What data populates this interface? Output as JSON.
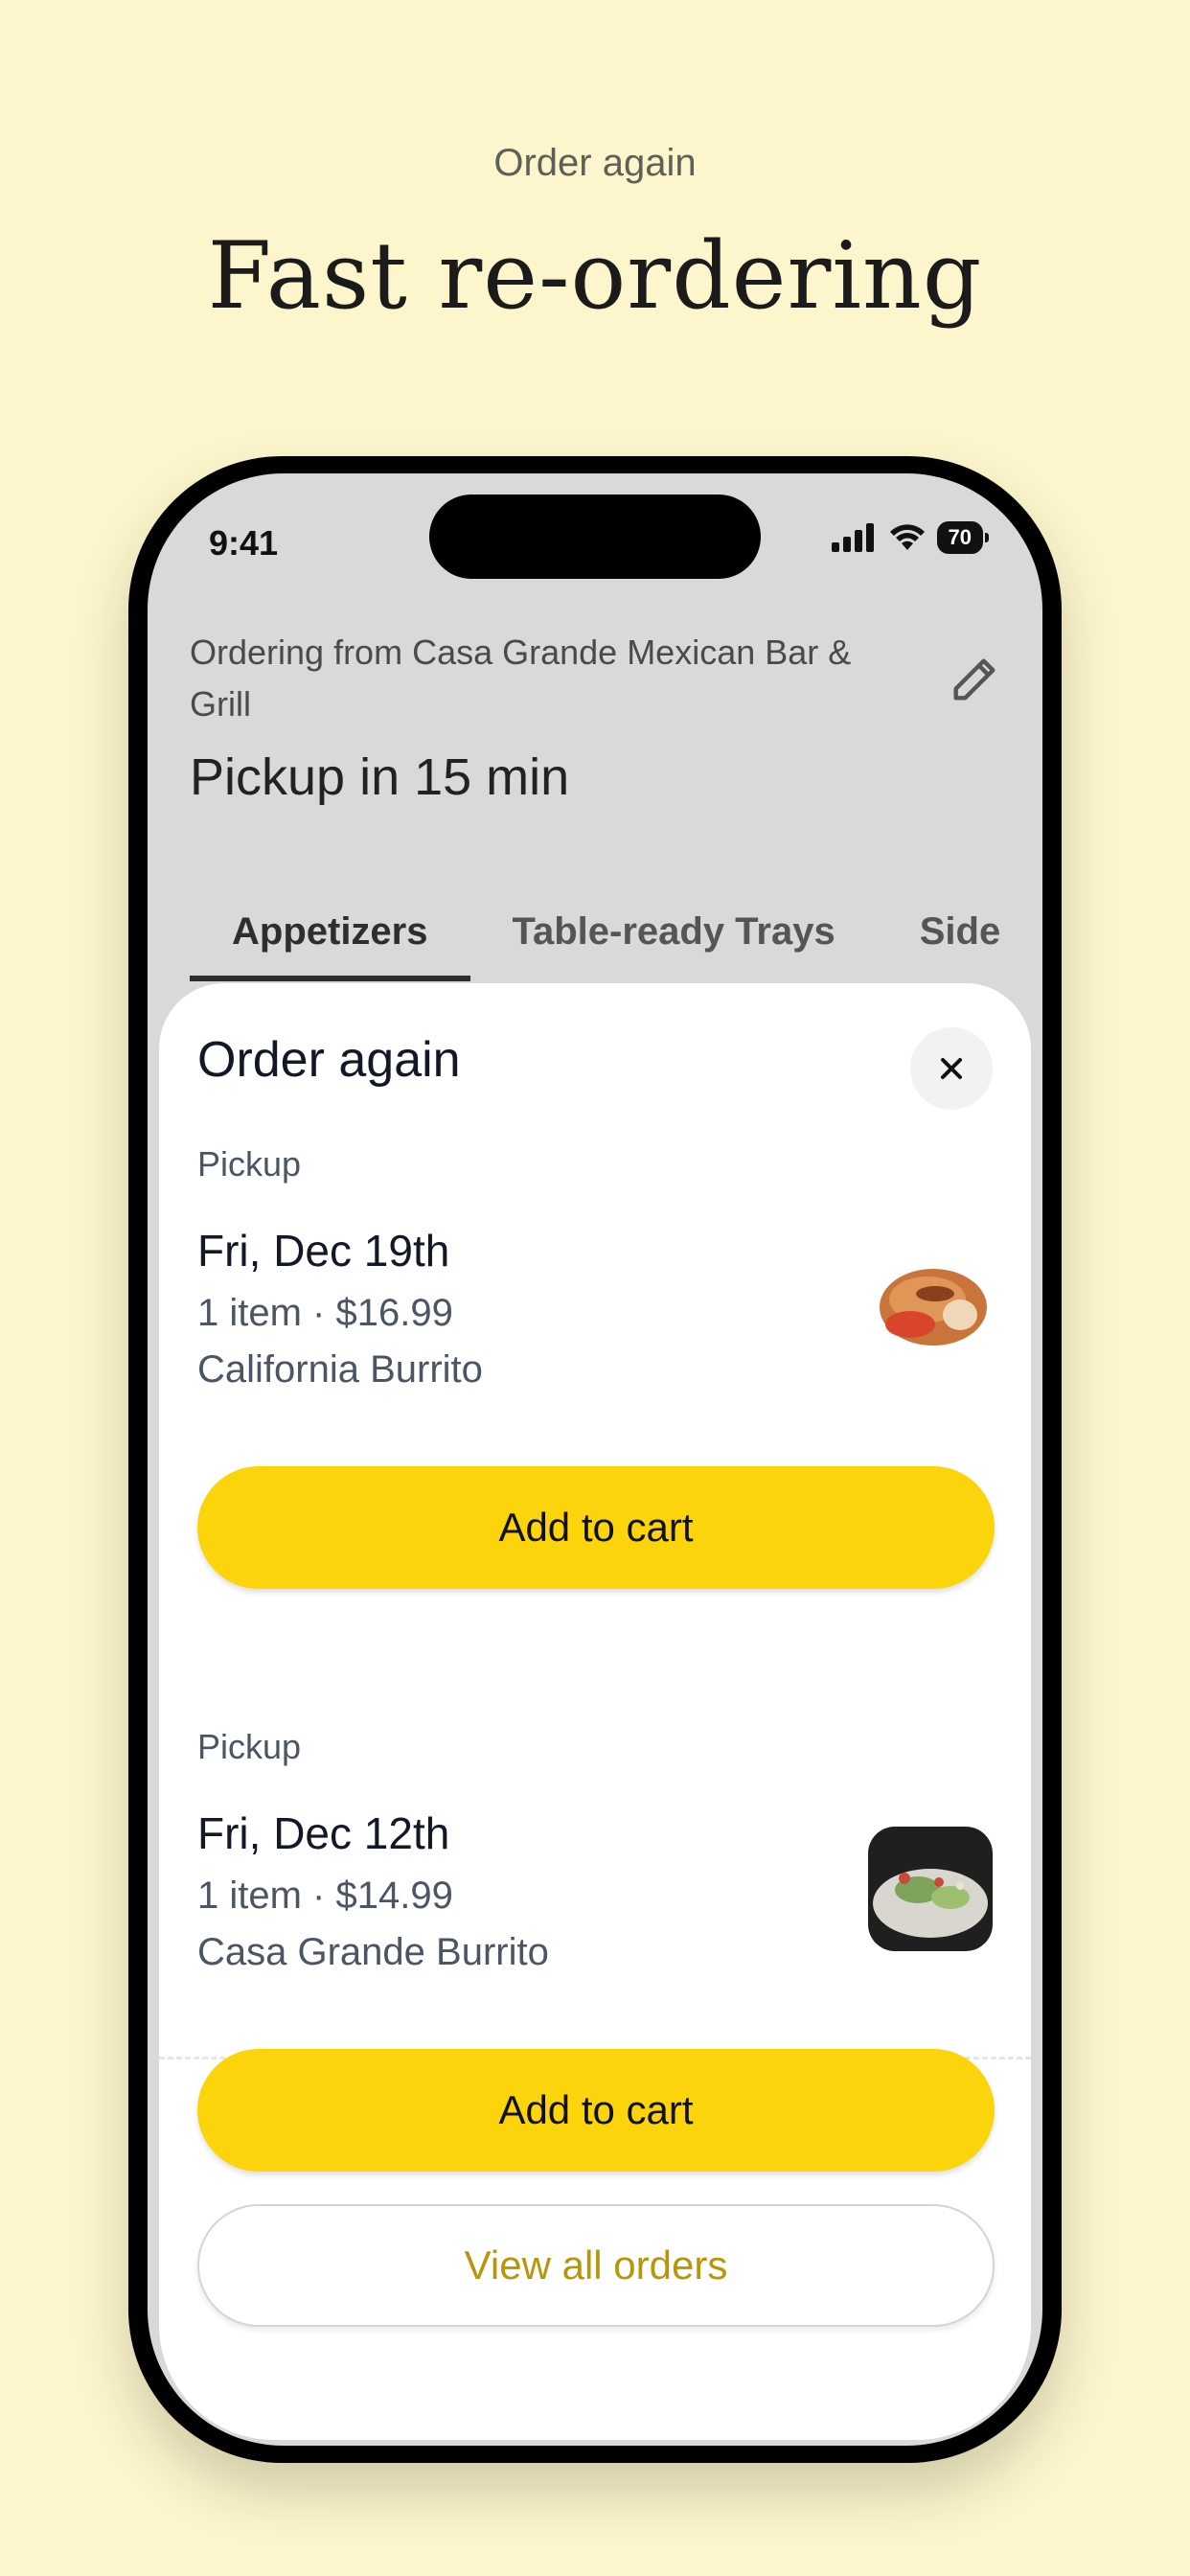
{
  "header": {
    "eyebrow": "Order again",
    "headline": "Fast re-ordering"
  },
  "status_bar": {
    "time": "9:41",
    "battery": "70",
    "icons": [
      "signal-icon",
      "wifi-icon",
      "battery-icon"
    ]
  },
  "store": {
    "ordering_from": "Ordering from Casa Grande Mexican Bar & Grill",
    "pickup_time": "Pickup in 15 min",
    "edit_icon": "pencil-icon"
  },
  "tabs": [
    {
      "label": "Appetizers",
      "active": true
    },
    {
      "label": "Table-ready Trays",
      "active": false
    },
    {
      "label": "Side",
      "active": false
    }
  ],
  "sheet": {
    "title": "Order again",
    "close_icon": "close-icon",
    "orders": [
      {
        "type": "Pickup",
        "date": "Fri, Dec 19th",
        "meta": "1 item · $16.99",
        "item": "California Burrito",
        "button": "Add to cart"
      },
      {
        "type": "Pickup",
        "date": "Fri, Dec 12th",
        "meta": "1 item · $14.99",
        "item": "Casa Grande Burrito",
        "button": "Add to cart"
      }
    ],
    "view_all": "View all orders"
  },
  "colors": {
    "background": "#fdf6cc",
    "accent": "#fbd40c",
    "link": "#b8960a"
  }
}
